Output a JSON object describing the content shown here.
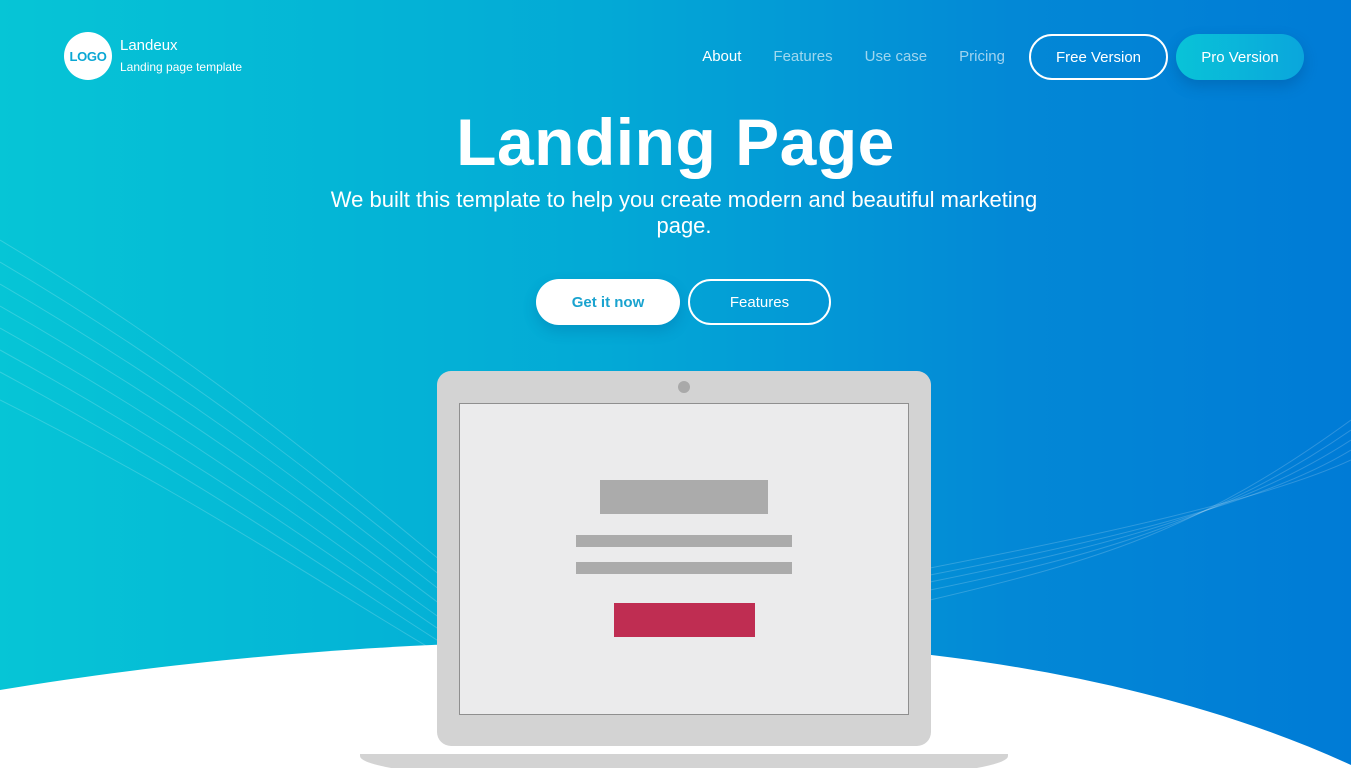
{
  "brand": {
    "logo_text": "LOGO",
    "name": "Landeux",
    "tagline": "Landing page template"
  },
  "nav": {
    "links": [
      {
        "label": "About",
        "active": true
      },
      {
        "label": "Features",
        "active": false
      },
      {
        "label": "Use case",
        "active": false
      },
      {
        "label": "Pricing",
        "active": false
      }
    ],
    "free_button": "Free Version",
    "pro_button": "Pro Version"
  },
  "hero": {
    "title": "Landing Page",
    "subtitle": "We built this template to help you create modern and beautiful marketing page.",
    "primary_cta": "Get it now",
    "secondary_cta": "Features"
  },
  "colors": {
    "gradient_start": "#06c5d6",
    "gradient_end": "#007bd6",
    "primary_cta_text": "#1aa3cf",
    "laptop_body": "#d3d3d3",
    "screen_bg": "#ebebec",
    "placeholder": "#ababab",
    "accent_block": "#bf2d52"
  },
  "icons": {
    "logo": "logo-circle-icon",
    "camera": "camera-dot-icon"
  }
}
